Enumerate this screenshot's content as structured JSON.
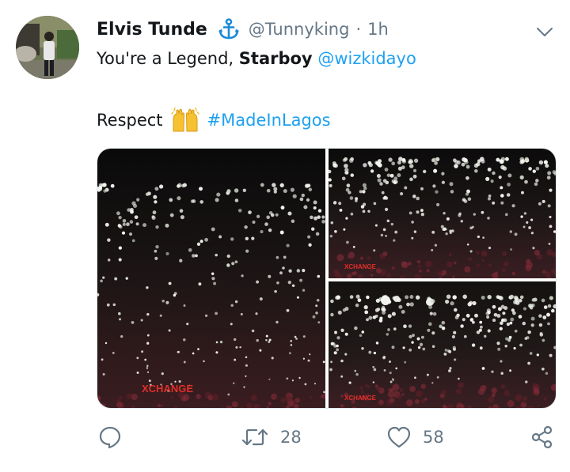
{
  "tweet": {
    "author_name": "Elvis Tunde",
    "handle": "@Tunnyking",
    "separator": "·",
    "time": "1h",
    "line1_prefix": "You're a Legend, ",
    "line1_bold": "Starboy",
    "mention": "@wizkidayo",
    "line2_prefix": "Respect",
    "hashtag": "#MadeInLagos",
    "watermarks": [
      "XCHANGE",
      "XCHANGE",
      "XCHANGE"
    ]
  },
  "actions": {
    "reply_count": "",
    "retweet_count": "28",
    "like_count": "58"
  },
  "colors": {
    "link": "#1da1f2",
    "muted": "#657786",
    "anchor_icon": "#1b8ad6"
  },
  "icons": [
    "anchor-icon",
    "chevron-down-icon",
    "raising-hands-emoji",
    "reply-icon",
    "retweet-icon",
    "like-icon",
    "share-icon"
  ]
}
